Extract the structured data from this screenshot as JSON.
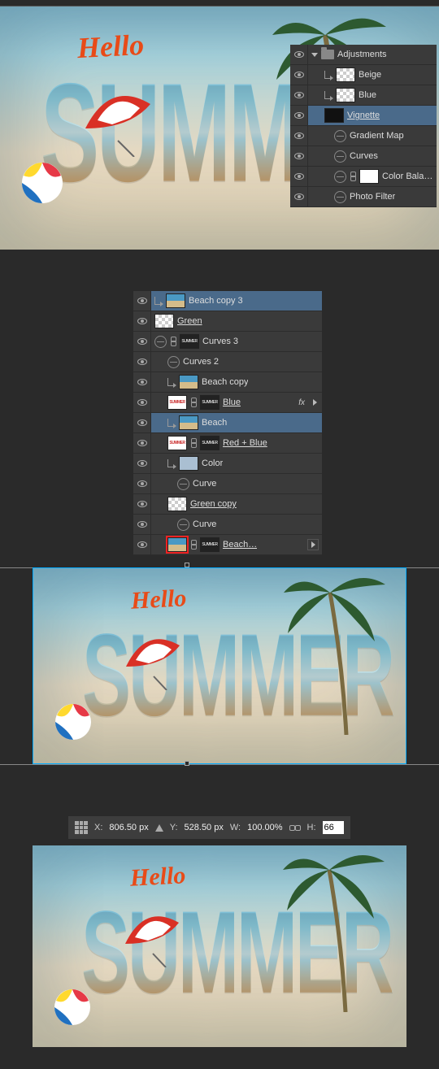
{
  "artwork": {
    "hello": "Hello",
    "summer": "SUMMER"
  },
  "panel1": {
    "rows": [
      {
        "indent": 0,
        "type": "group",
        "name": "Adjustments",
        "selected": false,
        "under": false,
        "arrow": "down",
        "folder": true
      },
      {
        "indent": 1,
        "type": "layer",
        "name": "Beige",
        "selected": false,
        "under": false,
        "clip": true,
        "thumb": "checker"
      },
      {
        "indent": 1,
        "type": "layer",
        "name": "Blue",
        "selected": false,
        "under": false,
        "clip": true,
        "thumb": "checker"
      },
      {
        "indent": 1,
        "type": "layer",
        "name": "Vignette",
        "selected": true,
        "under": true,
        "thumb": "dark"
      },
      {
        "indent": 2,
        "type": "adj",
        "name": "Gradient Map",
        "selected": false,
        "under": false
      },
      {
        "indent": 2,
        "type": "adj",
        "name": "Curves",
        "selected": false,
        "under": false
      },
      {
        "indent": 2,
        "type": "adj",
        "name": "Color Bala…",
        "selected": false,
        "under": false,
        "link": true,
        "mask": "white"
      },
      {
        "indent": 2,
        "type": "adj",
        "name": "Photo Filter",
        "selected": false,
        "under": false
      }
    ]
  },
  "panel2": {
    "rows": [
      {
        "indent": 0,
        "clip": true,
        "thumb": "img",
        "name": "Beach copy 3",
        "selected": true
      },
      {
        "indent": 0,
        "thumb": "checker",
        "name": "Green",
        "under": true
      },
      {
        "indent": 0,
        "adj": true,
        "link": true,
        "mask": "mask-txt",
        "name": "Curves 3"
      },
      {
        "indent": 1,
        "adj": true,
        "name": "Curves 2"
      },
      {
        "indent": 1,
        "clip": true,
        "thumb": "img",
        "name": "Beach copy"
      },
      {
        "indent": 1,
        "thumb": "summer-txt",
        "link": true,
        "mask": "mask-txt",
        "name": "Blue",
        "under": true,
        "fx": true
      },
      {
        "indent": 1,
        "clip": true,
        "thumb": "img",
        "name": "Beach",
        "selected": true
      },
      {
        "indent": 1,
        "thumb": "summer-txt",
        "link": true,
        "mask": "mask-txt",
        "name": "Red + Blue",
        "under": true
      },
      {
        "indent": 1,
        "clip": true,
        "thumb": "color",
        "name": "Color"
      },
      {
        "indent": 2,
        "adj": true,
        "name": "Curve"
      },
      {
        "indent": 1,
        "thumb": "checker",
        "name": "Green copy",
        "under": true
      },
      {
        "indent": 2,
        "adj": true,
        "name": "Curve"
      },
      {
        "indent": 1,
        "thumb": "img",
        "red": true,
        "link": true,
        "mask": "mask-txt",
        "name": "Beach…",
        "under": true,
        "popout": true
      }
    ]
  },
  "options": {
    "x_label": "X:",
    "x_val": "806.50 px",
    "y_label": "Y:",
    "y_val": "528.50 px",
    "w_label": "W:",
    "w_val": "100.00%",
    "h_label": "H:",
    "h_val": "66"
  }
}
